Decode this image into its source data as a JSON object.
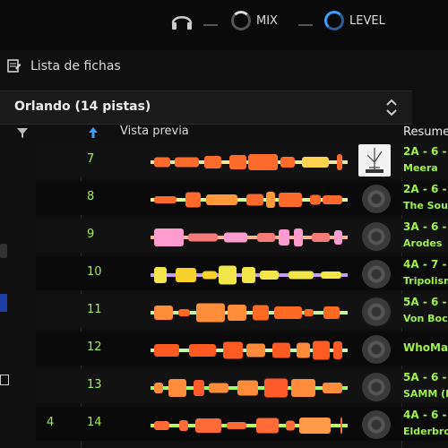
{
  "top_controls": {
    "headphones_icon": "headphones-icon",
    "mix_label": "MIX",
    "level_label": "LEVEL"
  },
  "tracklist": {
    "section_title": "Lista de fichas",
    "list_title": "Orlando (14 pistas)",
    "columns": {
      "preview": "Vista previa",
      "summary": "Resume"
    }
  },
  "rows": [
    {
      "num": "7",
      "key": "2A - 6 -",
      "artist": "Meera",
      "art": "cover"
    },
    {
      "num": "8",
      "key": "2A - 6 -",
      "artist": "The Soun",
      "art": "disc"
    },
    {
      "num": "9",
      "key": "3A - 6 -",
      "artist": "Arodes",
      "art": "disc"
    },
    {
      "num": "10",
      "key": "4A - 7 -",
      "artist": "Tripolism",
      "art": "disc"
    },
    {
      "num": "11",
      "key": "5A - 6 -",
      "artist": "Von Boch",
      "art": "disc"
    },
    {
      "num": "12",
      "key": "WhoMa",
      "artist": "",
      "art": "disc"
    },
    {
      "num": "13",
      "key": "5A - 6 -",
      "artist": "SAMM (E",
      "art": "disc"
    },
    {
      "num": "14",
      "key": "4A - 6 -",
      "artist": "Elderbroo",
      "art": "disc",
      "left": "4"
    }
  ],
  "colors": {
    "accent_green": "#9ff24a",
    "accent_blue": "#3aa0ff"
  }
}
